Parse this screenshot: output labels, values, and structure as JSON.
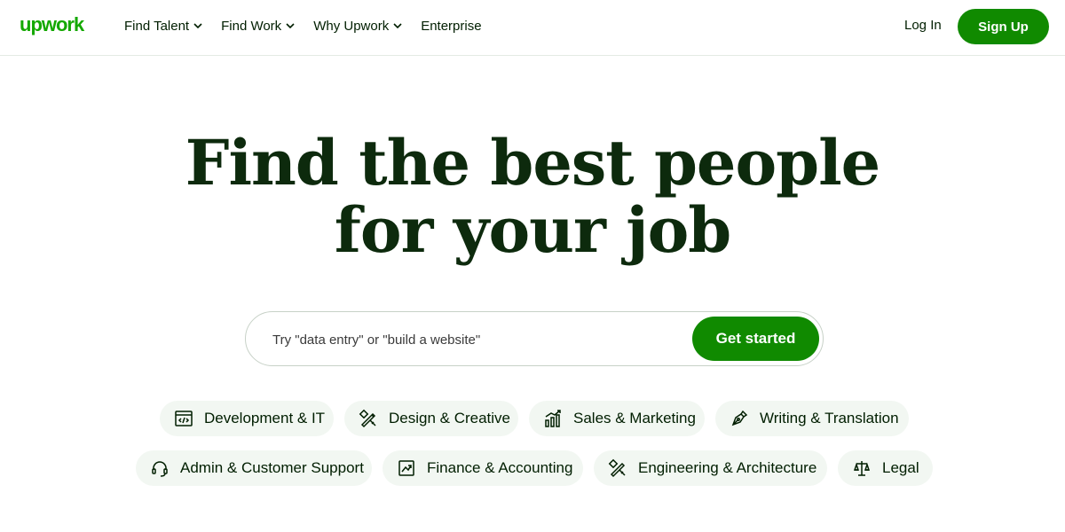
{
  "header": {
    "logo_text": "upwork",
    "nav": [
      {
        "label": "Find Talent",
        "has_dropdown": true
      },
      {
        "label": "Find Work",
        "has_dropdown": true
      },
      {
        "label": "Why Upwork",
        "has_dropdown": true
      },
      {
        "label": "Enterprise",
        "has_dropdown": false
      }
    ],
    "login_label": "Log In",
    "signup_label": "Sign Up"
  },
  "hero": {
    "title_line1": "Find the best people",
    "title_line2": "for your job"
  },
  "search": {
    "placeholder": "Try \"data entry\" or \"build a website\"",
    "value": "",
    "button_label": "Get started"
  },
  "categories": [
    {
      "label": "Development & IT",
      "icon": "code-window-icon"
    },
    {
      "label": "Design & Creative",
      "icon": "design-tools-icon"
    },
    {
      "label": "Sales & Marketing",
      "icon": "bar-chart-icon"
    },
    {
      "label": "Writing & Translation",
      "icon": "pen-nib-icon"
    },
    {
      "label": "Admin & Customer Support",
      "icon": "headset-icon"
    },
    {
      "label": "Finance & Accounting",
      "icon": "trend-chart-icon"
    },
    {
      "label": "Engineering & Architecture",
      "icon": "drafting-tools-icon"
    },
    {
      "label": "Legal",
      "icon": "scales-icon"
    }
  ],
  "colors": {
    "brand_green": "#108a00",
    "text_dark": "#001e00",
    "pill_bg": "#f2f7f2"
  }
}
